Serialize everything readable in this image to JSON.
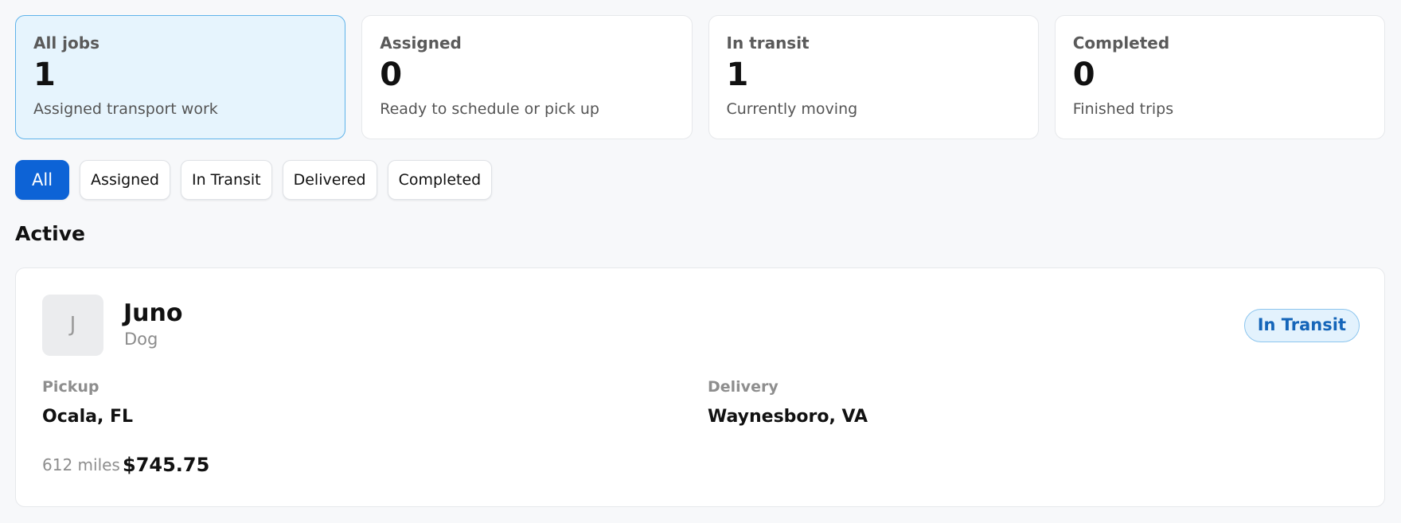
{
  "stats": [
    {
      "label": "All jobs",
      "value": "1",
      "description": "Assigned transport work",
      "selected": true
    },
    {
      "label": "Assigned",
      "value": "0",
      "description": "Ready to schedule or pick up",
      "selected": false
    },
    {
      "label": "In transit",
      "value": "1",
      "description": "Currently moving",
      "selected": false
    },
    {
      "label": "Completed",
      "value": "0",
      "description": "Finished trips",
      "selected": false
    }
  ],
  "filters": [
    {
      "label": "All",
      "active": true
    },
    {
      "label": "Assigned",
      "active": false
    },
    {
      "label": "In Transit",
      "active": false
    },
    {
      "label": "Delivered",
      "active": false
    },
    {
      "label": "Completed",
      "active": false
    }
  ],
  "section": {
    "title": "Active"
  },
  "job": {
    "avatar_initial": "J",
    "name": "Juno",
    "type": "Dog",
    "status": "In Transit",
    "pickup_label": "Pickup",
    "pickup_location": "Ocala, FL",
    "delivery_label": "Delivery",
    "delivery_location": "Waynesboro, VA",
    "distance": "612 miles",
    "price": "$745.75"
  },
  "colors": {
    "accent": "#0d63d6",
    "selected_card_bg": "#e6f4fd",
    "selected_card_border": "#5fb3ea",
    "status_badge_bg": "#e3f2fd",
    "status_badge_text": "#1565b9"
  }
}
